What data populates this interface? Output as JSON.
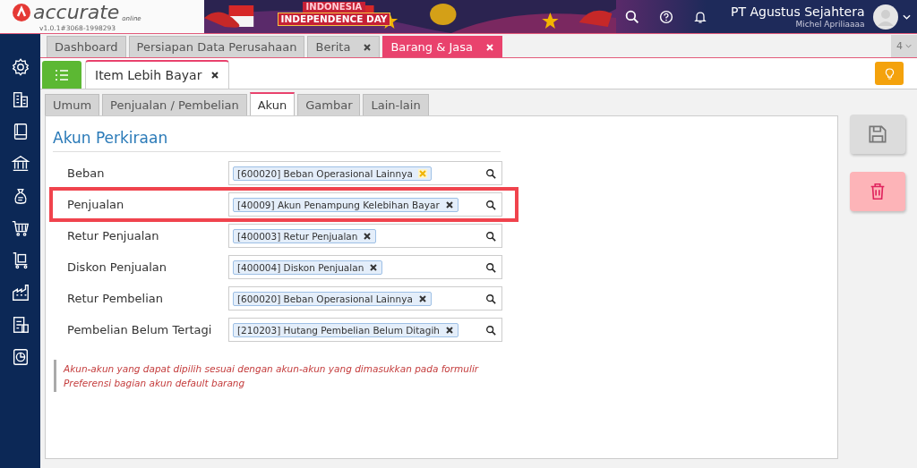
{
  "header": {
    "logo": "accurate",
    "logo_sub": "online",
    "version": "v1.0.1#3068-1998293",
    "banner_line1": "INDONESIA",
    "banner_line2": "INDEPENDENCE DAY",
    "company": "PT Agustus Sejahtera",
    "user": "Michel Apriliaaaa"
  },
  "sidebar": {
    "items": [
      {
        "kind": "gear"
      },
      {
        "kind": "building"
      },
      {
        "kind": "book"
      },
      {
        "kind": "bank"
      },
      {
        "kind": "moneybag"
      },
      {
        "kind": "cart"
      },
      {
        "kind": "trolley"
      },
      {
        "kind": "factory"
      },
      {
        "kind": "tax"
      },
      {
        "kind": "report"
      }
    ]
  },
  "tabs": [
    {
      "label": "Dashboard",
      "closable": false,
      "selected": false
    },
    {
      "label": "Persiapan Data Perusahaan",
      "closable": false,
      "selected": false
    },
    {
      "label": "Berita",
      "closable": true,
      "selected": false
    },
    {
      "label": "Barang & Jasa",
      "closable": true,
      "selected": true
    }
  ],
  "tab_count": "4",
  "doc_tab": {
    "label": "Item Lebih Bayar"
  },
  "sub_tabs": [
    {
      "label": "Umum",
      "selected": false
    },
    {
      "label": "Penjualan / Pembelian",
      "selected": false
    },
    {
      "label": "Akun",
      "selected": true
    },
    {
      "label": "Gambar",
      "selected": false
    },
    {
      "label": "Lain-lain",
      "selected": false
    }
  ],
  "section_title": "Akun Perkiraan",
  "fields": [
    {
      "label": "Beban",
      "value": "[600020] Beban Operasional Lainnya",
      "hovered": true,
      "highlighted": false
    },
    {
      "label": "Penjualan",
      "value": "[40009] Akun Penampung Kelebihan Bayar",
      "hovered": false,
      "highlighted": true
    },
    {
      "label": "Retur Penjualan",
      "value": "[400003] Retur Penjualan",
      "hovered": false,
      "highlighted": false
    },
    {
      "label": "Diskon Penjualan",
      "value": "[400004] Diskon Penjualan",
      "hovered": false,
      "highlighted": false
    },
    {
      "label": "Retur Pembelian",
      "value": "[600020] Beban Operasional Lainnya",
      "hovered": false,
      "highlighted": false
    },
    {
      "label": "Pembelian Belum Tertagi",
      "value": "[210203] Hutang Pembelian Belum Ditagih",
      "hovered": false,
      "highlighted": false
    }
  ],
  "note": "Akun-akun yang dapat dipilih sesuai dengan akun-akun yang dimasukkan pada formulir Preferensi bagian akun default barang"
}
